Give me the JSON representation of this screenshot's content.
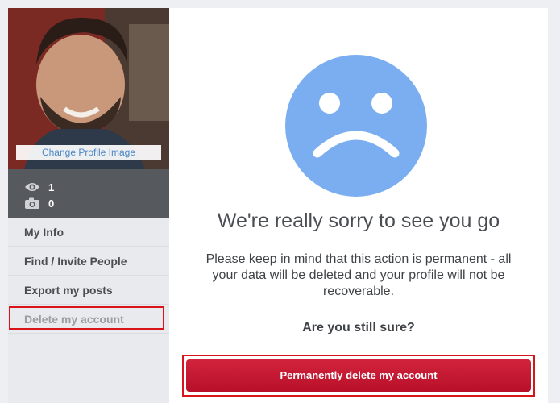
{
  "sidebar": {
    "change_image_label": "Change Profile Image",
    "stats": {
      "views": "1",
      "photos": "0"
    },
    "menu": [
      {
        "label": "My Info"
      },
      {
        "label": "Find / Invite People"
      },
      {
        "label": "Export my posts"
      },
      {
        "label": "Delete my account"
      }
    ]
  },
  "main": {
    "title": "We're really sorry to see you go",
    "warning": "Please keep in mind that this action is permanent - all your data will be deleted and your profile will not be recoverable.",
    "confirm_question": "Are you still sure?",
    "delete_button_label": "Permanently delete my account"
  },
  "colors": {
    "sad_face": "#7aaef0",
    "delete_button": "#c8173a",
    "highlight": "#d8141a"
  }
}
